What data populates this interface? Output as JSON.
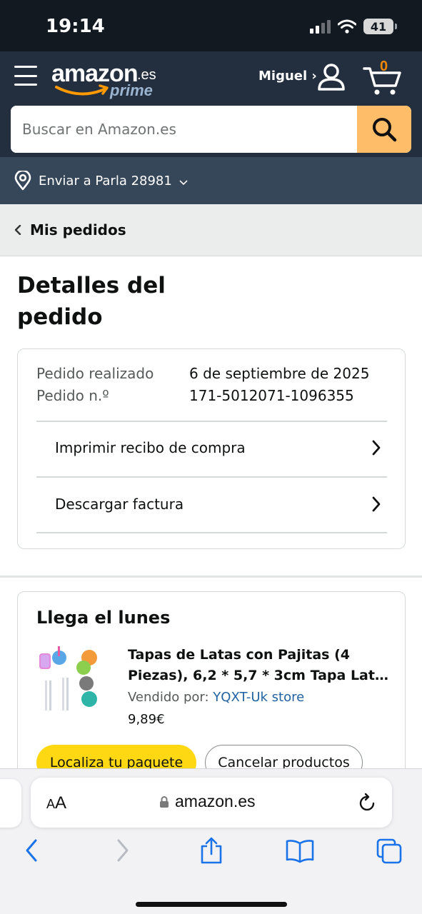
{
  "status": {
    "time": "19:14",
    "battery": "41"
  },
  "header": {
    "logo_word": "amazon",
    "logo_suffix": ".es",
    "logo_prime": "prime",
    "account_name": "Miguel ›",
    "cart_count": "0",
    "search_placeholder": "Buscar en Amazon.es",
    "deliver_to": "Enviar a Parla 28981"
  },
  "breadcrumb": {
    "label": "Mis pedidos"
  },
  "page": {
    "title": "Detalles del pedido"
  },
  "order": {
    "placed_label": "Pedido realizado",
    "placed_value": "6 de septiembre de 2025",
    "number_label": "Pedido n.º",
    "number_value": "171-5012071-1096355",
    "links": [
      "Imprimir recibo de compra",
      "Descargar factura"
    ]
  },
  "shipment": {
    "arrival": "Llega el lunes",
    "product_title": "Tapas de Latas con Pajitas (4 Piezas), 6,2 * 5,7 * 3cm Tapa Lat…",
    "seller_label": "Vendido por: ",
    "seller_name": "YQXT-Uk store",
    "price": "9,89€",
    "track_button": "Localiza tu paquete",
    "cancel_button": "Cancelar productos"
  },
  "browser": {
    "aa_small": "A",
    "aa_big": "A",
    "url": "amazon.es"
  }
}
